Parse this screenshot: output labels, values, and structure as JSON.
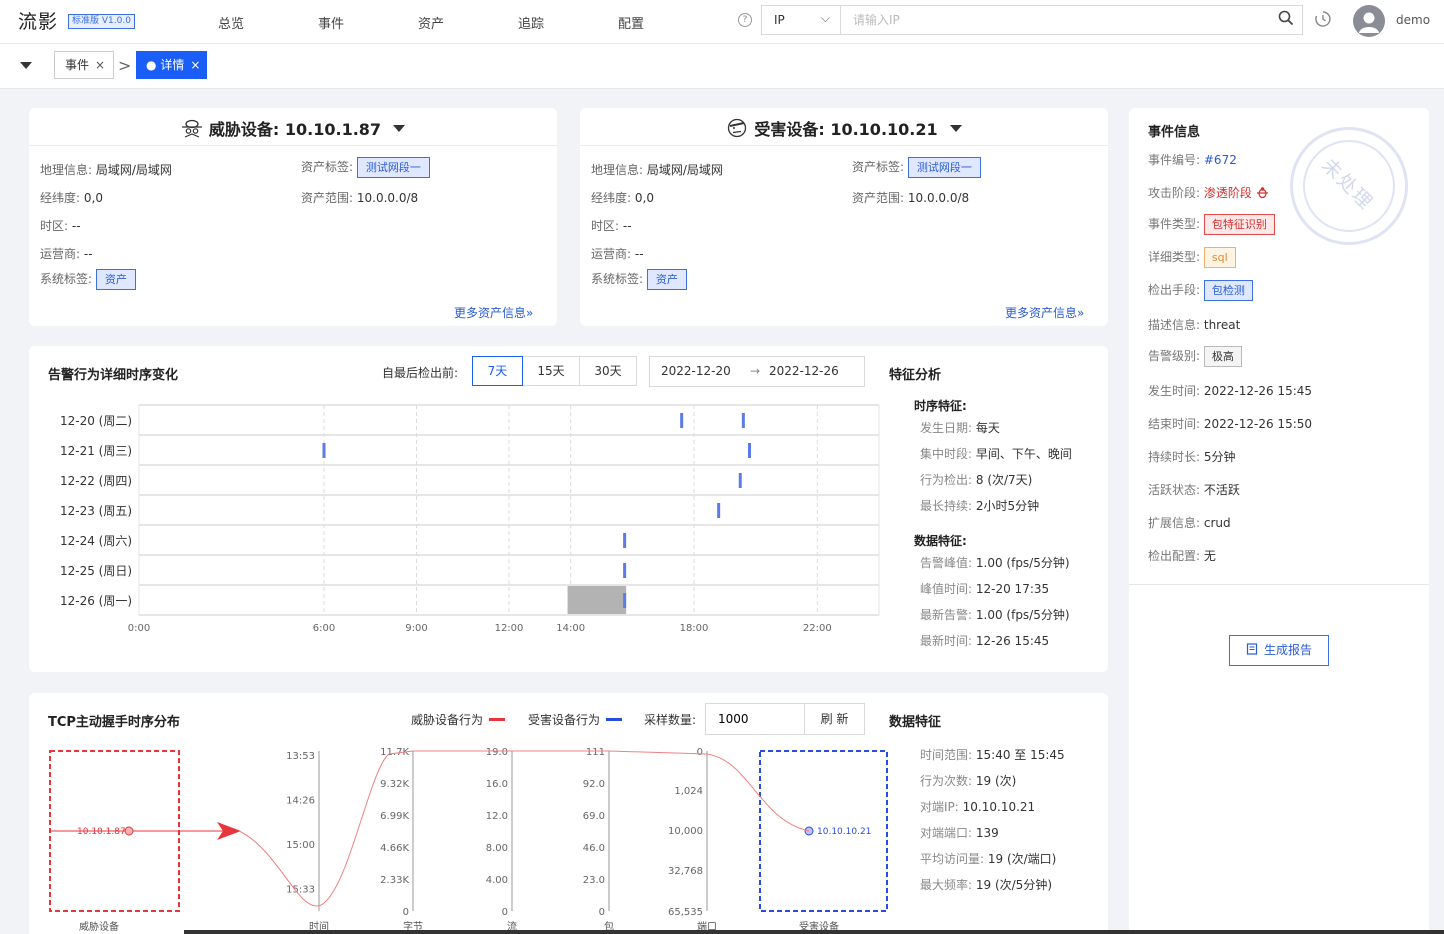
{
  "topbar": {
    "logo": "流影",
    "version": "标准版 V1.0.0",
    "nav": [
      "总览",
      "事件",
      "资产",
      "追踪",
      "配置"
    ],
    "help": "?",
    "search_type": "IP",
    "search_placeholder": "请输入IP",
    "username": "demo"
  },
  "tabs": {
    "items": [
      "事件",
      "详情"
    ],
    "close": "×",
    "active_prefix": "●"
  },
  "threat_device": {
    "title": "威胁设备: 10.10.1.87",
    "fields": [
      {
        "k": "地理信息:",
        "v": "局域网/局域网"
      },
      {
        "k": "经纬度:",
        "v": "0,0"
      },
      {
        "k": "时区:",
        "v": "--"
      },
      {
        "k": "运营商:",
        "v": "--"
      },
      {
        "k": "系统标签:",
        "v": "资产"
      }
    ],
    "asset_tag_label": "资产标签:",
    "asset_tag": "测试网段一",
    "asset_range_label": "资产范围:",
    "asset_range": "10.0.0.0/8",
    "more": "更多资产信息»"
  },
  "victim_device": {
    "title": "受害设备: 10.10.10.21",
    "fields": [
      {
        "k": "地理信息:",
        "v": "局域网/局域网"
      },
      {
        "k": "经纬度:",
        "v": "0,0"
      },
      {
        "k": "时区:",
        "v": "--"
      },
      {
        "k": "运营商:",
        "v": "--"
      },
      {
        "k": "系统标签:",
        "v": "资产"
      }
    ],
    "asset_tag_label": "资产标签:",
    "asset_tag": "测试网段一",
    "asset_range_label": "资产范围:",
    "asset_range": "10.0.0.0/8",
    "more": "更多资产信息»"
  },
  "timeline": {
    "title": "告警行为详细时序变化",
    "since_label": "自最后检出前:",
    "ranges": [
      "7天",
      "15天",
      "30天"
    ],
    "active_range": "7天",
    "date_from": "2022-12-20",
    "date_arrow": "→",
    "date_to": "2022-12-26",
    "feature_title": "特征分析",
    "seq_title": "时序特征:",
    "seq": [
      {
        "k": "发生日期:",
        "v": "每天"
      },
      {
        "k": "集中时段:",
        "v": "早间、下午、晚间"
      },
      {
        "k": "行为检出:",
        "v": "8 (次/7天)"
      },
      {
        "k": "最长持续:",
        "v": "2小时5分钟"
      }
    ],
    "data_title": "数据特征:",
    "data": [
      {
        "k": "告警峰值:",
        "v": "1.00 (fps/5分钟)"
      },
      {
        "k": "峰值时间:",
        "v": "12-20 17:35"
      },
      {
        "k": "最新告警:",
        "v": "1.00 (fps/5分钟)"
      },
      {
        "k": "最新时间:",
        "v": "12-26 15:45"
      }
    ]
  },
  "chart_data": {
    "type": "scatter",
    "title": "告警行为详细时序变化",
    "y_categories": [
      "12-20 (周二)",
      "12-21 (周三)",
      "12-22 (周四)",
      "12-23 (周五)",
      "12-24 (周六)",
      "12-25 (周日)",
      "12-26 (周一)"
    ],
    "x_ticks": [
      "0:00",
      "6:00",
      "9:00",
      "12:00",
      "14:00",
      "18:00",
      "22:00"
    ],
    "points": [
      {
        "day": 0,
        "hour": 17.6
      },
      {
        "day": 0,
        "hour": 19.6
      },
      {
        "day": 1,
        "hour": 6.0
      },
      {
        "day": 1,
        "hour": 19.8
      },
      {
        "day": 2,
        "hour": 19.5
      },
      {
        "day": 3,
        "hour": 18.8
      },
      {
        "day": 4,
        "hour": 15.75
      },
      {
        "day": 5,
        "hour": 15.75
      },
      {
        "day": 6,
        "hour": 15.75
      }
    ],
    "highlight": {
      "day": 6,
      "from": 13.9,
      "to": 15.8
    },
    "colors": {
      "point": "#5b7be8",
      "highlight": "#b3b3b3"
    }
  },
  "tcp": {
    "title": "TCP主动握手时序分布",
    "legend_threat": "威胁设备行为",
    "legend_victim": "受害设备行为",
    "sample_label": "采样数量:",
    "sample_value": "1000",
    "refresh": "刷 新",
    "feature_title": "数据特征",
    "features": [
      {
        "k": "时间范围:",
        "v": "15:40 至 15:45"
      },
      {
        "k": "行为次数:",
        "v": "19 (次)"
      },
      {
        "k": "对端IP:",
        "v": "10.10.10.21"
      },
      {
        "k": "对端端口:",
        "v": "139"
      },
      {
        "k": "平均访问量:",
        "v": "19 (次/端口)"
      },
      {
        "k": "最大频率:",
        "v": "19 (次/5分钟)"
      }
    ],
    "threat_ip": "10.10.1.87",
    "victim_ip": "10.10.10.21",
    "axes": [
      {
        "name": "威胁设备",
        "ticks": []
      },
      {
        "name": "时间",
        "ticks": [
          "13:53",
          "14:26",
          "15:00",
          "15:33"
        ]
      },
      {
        "name": "字节",
        "ticks": [
          "11.7K",
          "9.32K",
          "6.99K",
          "4.66K",
          "2.33K",
          "0"
        ]
      },
      {
        "name": "流",
        "ticks": [
          "19.0",
          "16.0",
          "12.0",
          "8.00",
          "4.00",
          "0"
        ]
      },
      {
        "name": "包",
        "ticks": [
          "111",
          "92.0",
          "69.0",
          "46.0",
          "23.0",
          "0"
        ]
      },
      {
        "name": "端口",
        "ticks": [
          "0",
          "1,024",
          "10,000",
          "32,768",
          "65,535"
        ]
      },
      {
        "name": "受害设备",
        "ticks": []
      }
    ],
    "colors": {
      "threat": "#e8343b",
      "victim": "#2a4bdf"
    }
  },
  "event_info": {
    "title": "事件信息",
    "stamp": "未处理",
    "rows": [
      {
        "k": "事件编号:",
        "v": "#672"
      },
      {
        "k": "攻击阶段:",
        "v": "渗透阶段"
      },
      {
        "k": "事件类型:",
        "v": "包特征识别"
      },
      {
        "k": "详细类型:",
        "v": "sql"
      },
      {
        "k": "检出手段:",
        "v": "包检测"
      },
      {
        "k": "描述信息:",
        "v": "threat"
      },
      {
        "k": "告警级别:",
        "v": "极高"
      },
      {
        "k": "发生时间:",
        "v": "2022-12-26 15:45"
      },
      {
        "k": "结束时间:",
        "v": "2022-12-26 15:50"
      },
      {
        "k": "持续时长:",
        "v": "5分钟"
      },
      {
        "k": "活跃状态:",
        "v": "不活跃"
      },
      {
        "k": "扩展信息:",
        "v": "crud"
      },
      {
        "k": "检出配置:",
        "v": "无"
      }
    ],
    "report": "生成报告"
  }
}
